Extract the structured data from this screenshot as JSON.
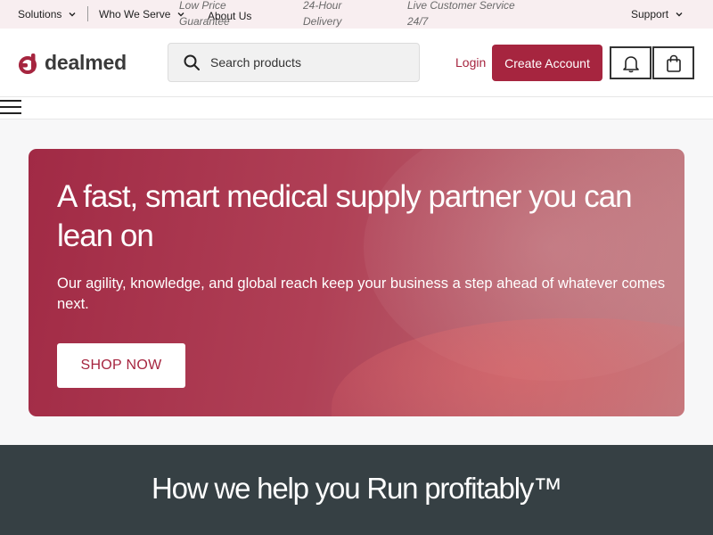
{
  "topbar": {
    "solutions": "Solutions",
    "who_we_serve": "Who We Serve",
    "about_us": "About Us",
    "notes": [
      {
        "line1": "Low Price",
        "line2": "Guarantee"
      },
      {
        "line1": "24-Hour",
        "line2": "Delivery"
      },
      {
        "line1": "Live Customer Service",
        "line2": "24/7"
      }
    ],
    "support": "Support",
    "chevron_icon": "chevron-down-icon"
  },
  "header": {
    "logo_text": "dealmed",
    "logo_icon": "dealmed-logo-icon",
    "search_placeholder": "Search products",
    "search_icon": "search-icon",
    "login": "Login",
    "create_account": "Create Account",
    "bell_icon": "bell-icon",
    "bag_icon": "shopping-bag-icon"
  },
  "nav": {
    "menu_icon": "hamburger-menu-icon"
  },
  "hero": {
    "title": "A fast, smart medical supply partner you can lean on",
    "subtitle": "Our agility, knowledge, and global reach keep your business a step ahead of whatever comes next.",
    "cta": "SHOP NOW"
  },
  "band": {
    "title": "How we help you Run profitably™"
  },
  "colors": {
    "brand": "#a6253f",
    "topbar_bg": "#f8eef0",
    "band_bg": "#364044"
  }
}
